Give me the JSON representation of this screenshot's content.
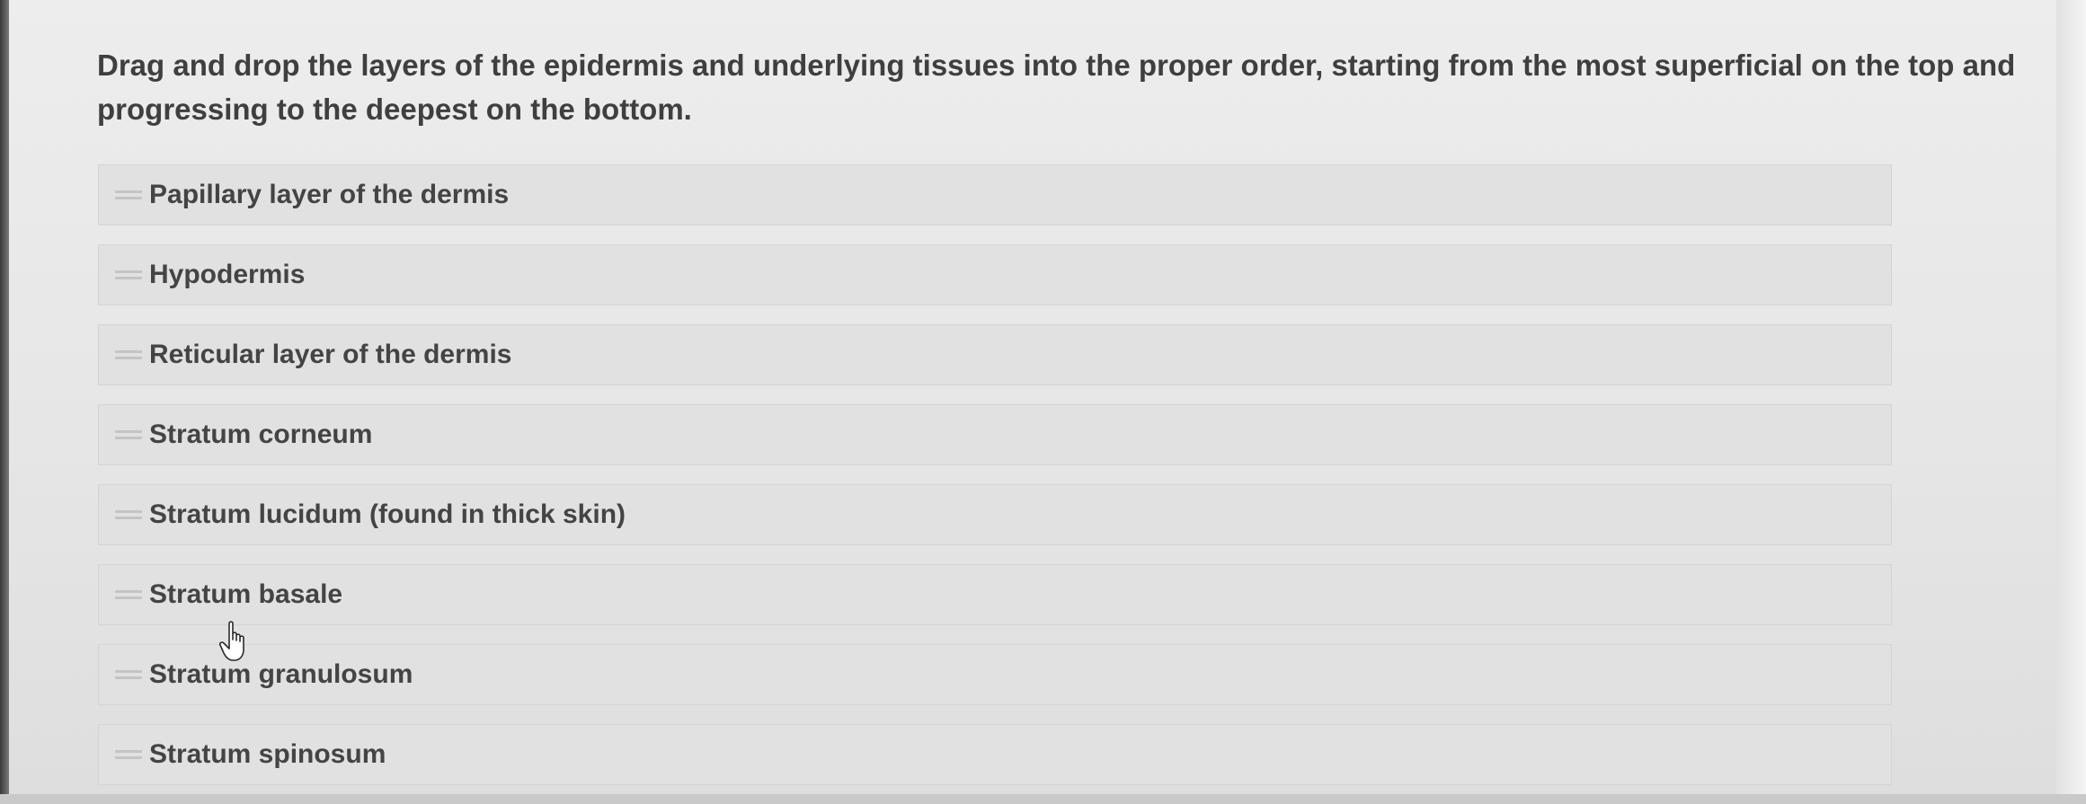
{
  "question": {
    "prompt": "Drag and drop the layers of the epidermis and underlying tissues into the proper order, starting from the most superficial on the top and progressing to the deepest on the bottom."
  },
  "items": [
    {
      "label": "Papillary layer of the dermis",
      "handle_icon": "drag-handle-icon"
    },
    {
      "label": "Hypodermis",
      "handle_icon": "drag-handle-icon"
    },
    {
      "label": "Reticular layer of the dermis",
      "handle_icon": "drag-handle-icon"
    },
    {
      "label": "Stratum corneum",
      "handle_icon": "drag-handle-icon"
    },
    {
      "label": "Stratum lucidum (found in thick skin)",
      "handle_icon": "drag-handle-icon"
    },
    {
      "label": "Stratum basale",
      "handle_icon": "drag-handle-icon"
    },
    {
      "label": "Stratum granulosum",
      "handle_icon": "drag-handle-icon"
    },
    {
      "label": "Stratum spinosum",
      "handle_icon": "drag-handle-icon"
    }
  ],
  "cursor": {
    "icon": "hand-pointer-icon"
  },
  "colors": {
    "text": "#444444",
    "item_background": "#e1e1e1",
    "handle": "#c4c4c4"
  }
}
